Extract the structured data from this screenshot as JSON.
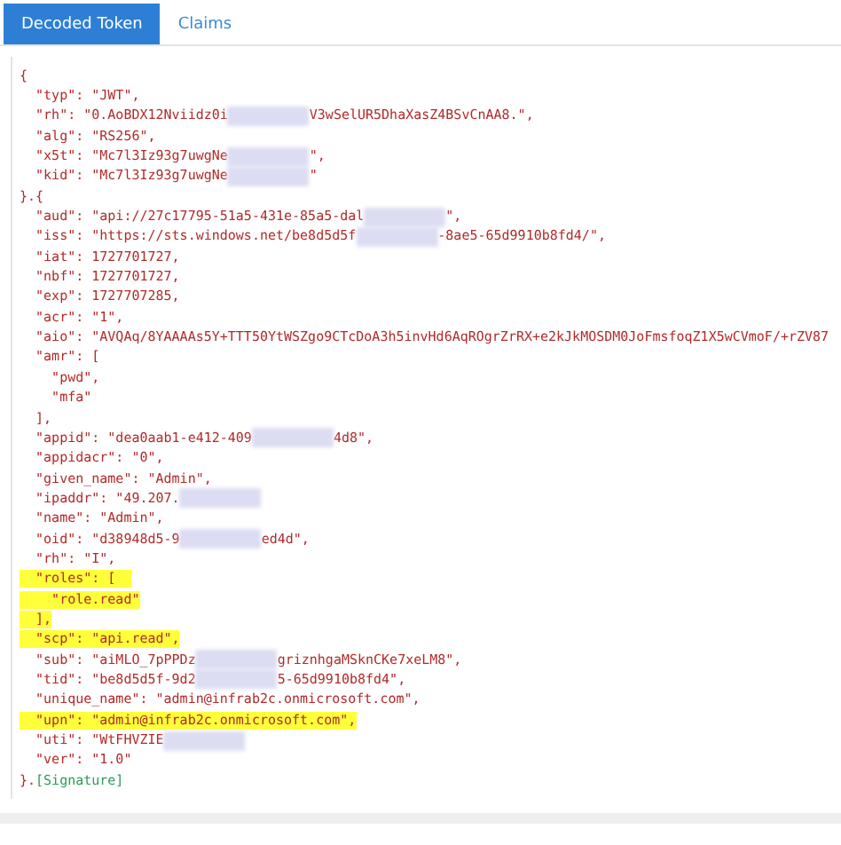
{
  "tabs": [
    {
      "label": "Decoded Token",
      "selected": true
    },
    {
      "label": "Claims",
      "selected": false
    }
  ],
  "lines": [
    {
      "highlighted": false,
      "parts": [
        {
          "kind": "text",
          "text": "{"
        }
      ]
    },
    {
      "highlighted": false,
      "parts": [
        {
          "kind": "text",
          "text": "  \"typ\": \"JWT\","
        }
      ]
    },
    {
      "highlighted": false,
      "parts": [
        {
          "kind": "text",
          "text": "  \"rh\": \"0.AoBDX12Nviidz0i"
        },
        {
          "kind": "redacted"
        },
        {
          "kind": "text",
          "text": "V3wSelUR5DhaXasZ4BSvCnAA8.\","
        }
      ]
    },
    {
      "highlighted": false,
      "parts": [
        {
          "kind": "text",
          "text": "  \"alg\": \"RS256\","
        }
      ]
    },
    {
      "highlighted": false,
      "parts": [
        {
          "kind": "text",
          "text": "  \"x5t\": \"Mc7l3Iz93g7uwgNe"
        },
        {
          "kind": "redacted"
        },
        {
          "kind": "text",
          "text": "\","
        }
      ]
    },
    {
      "highlighted": false,
      "parts": [
        {
          "kind": "text",
          "text": "  \"kid\": \"Mc7l3Iz93g7uwgNe"
        },
        {
          "kind": "redacted"
        },
        {
          "kind": "text",
          "text": "\""
        }
      ]
    },
    {
      "highlighted": false,
      "parts": [
        {
          "kind": "text",
          "text": "}.{"
        }
      ]
    },
    {
      "highlighted": false,
      "parts": [
        {
          "kind": "text",
          "text": "  \"aud\": \"api://27c17795-51a5-431e-85a5-dal"
        },
        {
          "kind": "redacted"
        },
        {
          "kind": "text",
          "text": "\","
        }
      ]
    },
    {
      "highlighted": false,
      "parts": [
        {
          "kind": "text",
          "text": "  \"iss\": \"https://sts.windows.net/be8d5d5f"
        },
        {
          "kind": "redacted"
        },
        {
          "kind": "text",
          "text": "-8ae5-65d9910b8fd4/\","
        }
      ]
    },
    {
      "highlighted": false,
      "parts": [
        {
          "kind": "text",
          "text": "  \"iat\": 1727701727,"
        }
      ]
    },
    {
      "highlighted": false,
      "parts": [
        {
          "kind": "text",
          "text": "  \"nbf\": 1727701727,"
        }
      ]
    },
    {
      "highlighted": false,
      "parts": [
        {
          "kind": "text",
          "text": "  \"exp\": 1727707285,"
        }
      ]
    },
    {
      "highlighted": false,
      "parts": [
        {
          "kind": "text",
          "text": "  \"acr\": \"1\","
        }
      ]
    },
    {
      "highlighted": false,
      "parts": [
        {
          "kind": "text",
          "text": "  \"aio\": \"AVQAq/8YAAAAs5Y+TTT50YtWSZgo9CTcDoA3h5invHd6AqROgrZrRX+e2kJkMOSDM0JoFmsfoqZ1X5wCVmoF/+rZV87"
        }
      ]
    },
    {
      "highlighted": false,
      "parts": [
        {
          "kind": "text",
          "text": "  \"amr\": ["
        }
      ]
    },
    {
      "highlighted": false,
      "parts": [
        {
          "kind": "text",
          "text": "    \"pwd\","
        }
      ]
    },
    {
      "highlighted": false,
      "parts": [
        {
          "kind": "text",
          "text": "    \"mfa\""
        }
      ]
    },
    {
      "highlighted": false,
      "parts": [
        {
          "kind": "text",
          "text": "  ],"
        }
      ]
    },
    {
      "highlighted": false,
      "parts": [
        {
          "kind": "text",
          "text": "  \"appid\": \"dea0aab1-e412-409"
        },
        {
          "kind": "redacted"
        },
        {
          "kind": "text",
          "text": "4d8\","
        }
      ]
    },
    {
      "highlighted": false,
      "parts": [
        {
          "kind": "text",
          "text": "  \"appidacr\": \"0\","
        }
      ]
    },
    {
      "highlighted": false,
      "parts": [
        {
          "kind": "text",
          "text": "  \"given_name\": \"Admin\","
        }
      ]
    },
    {
      "highlighted": false,
      "parts": [
        {
          "kind": "text",
          "text": "  \"ipaddr\": \"49.207."
        },
        {
          "kind": "redacted"
        }
      ]
    },
    {
      "highlighted": false,
      "parts": [
        {
          "kind": "text",
          "text": "  \"name\": \"Admin\","
        }
      ]
    },
    {
      "highlighted": false,
      "parts": [
        {
          "kind": "text",
          "text": "  \"oid\": \"d38948d5-9"
        },
        {
          "kind": "redacted"
        },
        {
          "kind": "text",
          "text": "ed4d\","
        }
      ]
    },
    {
      "highlighted": false,
      "parts": [
        {
          "kind": "text",
          "text": "  \"rh\": \"I\","
        }
      ]
    },
    {
      "highlighted": true,
      "parts": [
        {
          "kind": "text",
          "text": "  \"roles\": [  "
        }
      ]
    },
    {
      "highlighted": true,
      "parts": [
        {
          "kind": "text",
          "text": "    \"role.read\""
        }
      ]
    },
    {
      "highlighted": true,
      "parts": [
        {
          "kind": "text",
          "text": "  ],"
        }
      ]
    },
    {
      "highlighted": true,
      "parts": [
        {
          "kind": "text",
          "text": "  \"scp\": \"api.read\","
        }
      ]
    },
    {
      "highlighted": false,
      "parts": [
        {
          "kind": "text",
          "text": "  \"sub\": \"aiMLO_7pPPDz"
        },
        {
          "kind": "redacted"
        },
        {
          "kind": "text",
          "text": "griznhgaMSknCKe7xeLM8\","
        }
      ]
    },
    {
      "highlighted": false,
      "parts": [
        {
          "kind": "text",
          "text": "  \"tid\": \"be8d5d5f-9d2"
        },
        {
          "kind": "redacted"
        },
        {
          "kind": "text",
          "text": "5-65d9910b8fd4\","
        }
      ]
    },
    {
      "highlighted": false,
      "parts": [
        {
          "kind": "text",
          "text": "  \"unique_name\": \"admin@infrab2c.onmicrosoft.com\","
        }
      ]
    },
    {
      "highlighted": true,
      "parts": [
        {
          "kind": "text",
          "text": "  \"upn\": \"admin@infrab2c.onmicrosoft.com\","
        }
      ]
    },
    {
      "highlighted": false,
      "parts": [
        {
          "kind": "text",
          "text": "  \"uti\": \"WtFHVZIE"
        },
        {
          "kind": "redacted"
        }
      ]
    },
    {
      "highlighted": false,
      "parts": [
        {
          "kind": "text",
          "text": "  \"ver\": \"1.0\""
        }
      ]
    },
    {
      "highlighted": false,
      "parts": [
        {
          "kind": "text",
          "text": "}."
        },
        {
          "kind": "signature",
          "text": "[Signature]"
        }
      ]
    }
  ]
}
